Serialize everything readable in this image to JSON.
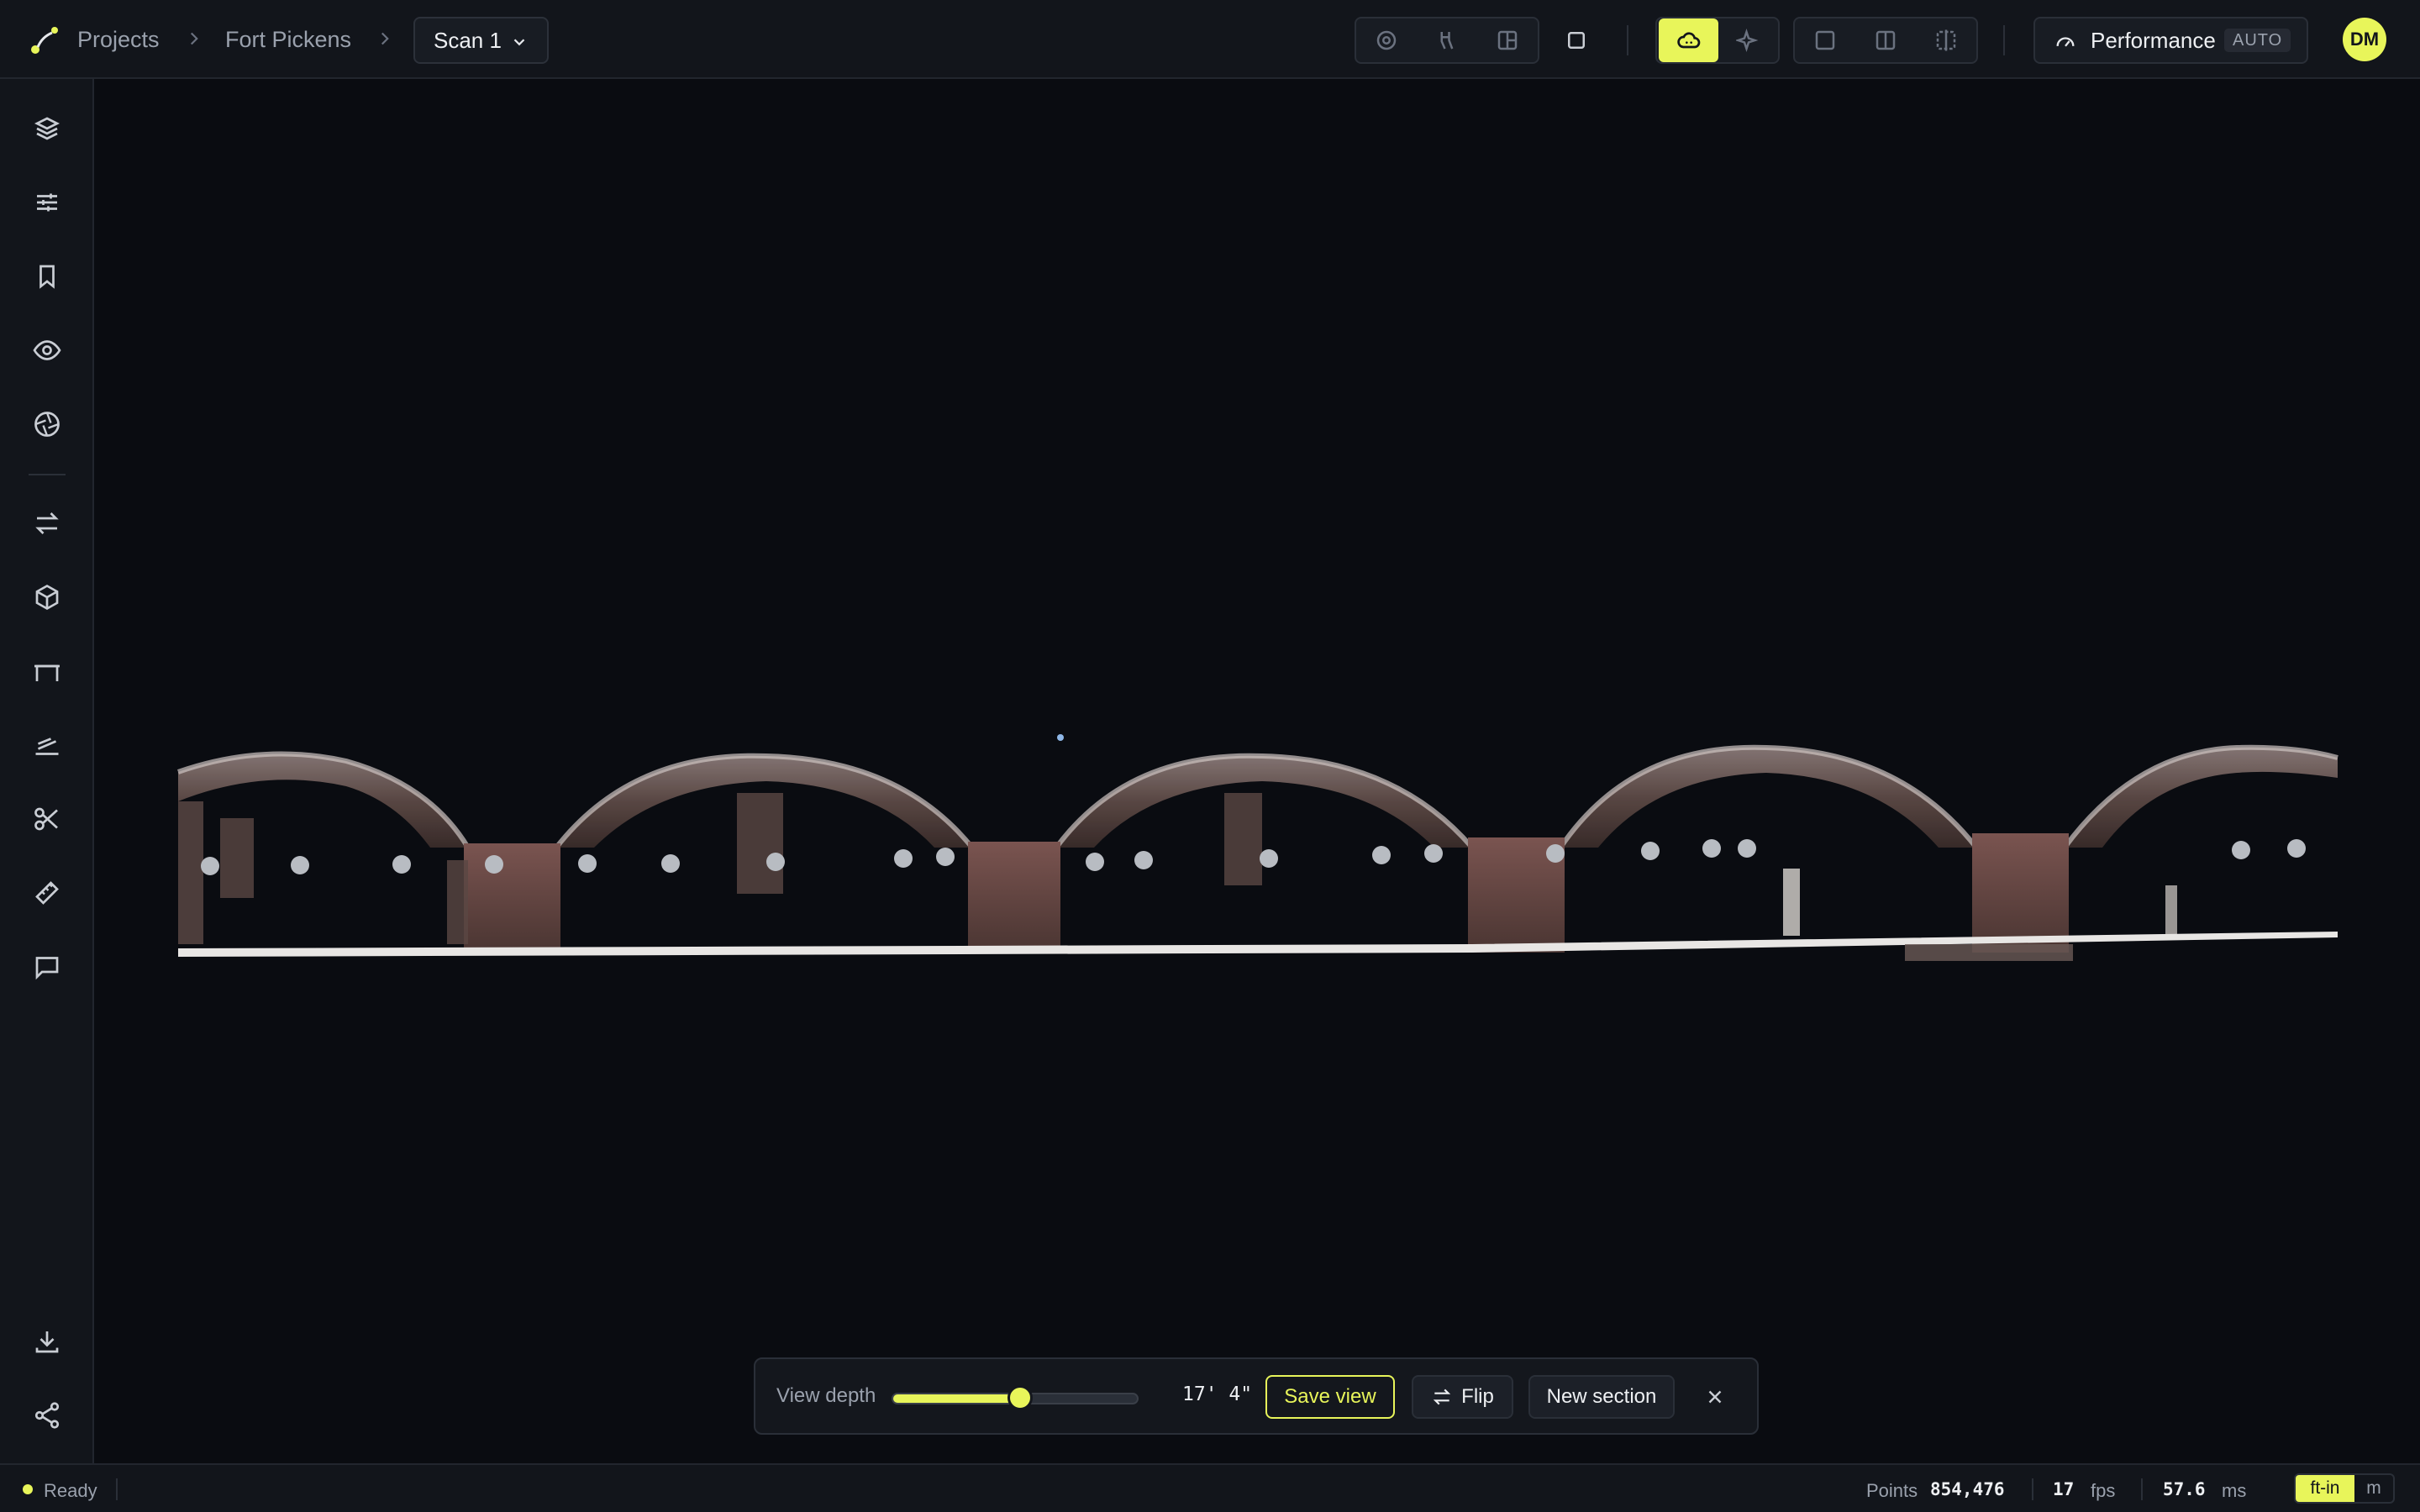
{
  "breadcrumb": {
    "projects": "Projects",
    "site": "Fort Pickens",
    "scan": "Scan 1"
  },
  "toolbar": {
    "performance_label": "Performance",
    "performance_mode": "AUTO",
    "avatar_initials": "DM",
    "accent_color": "#e8f55a",
    "icons": [
      "camera-orbit-icon",
      "walk-icon",
      "layout-icon",
      "square-icon",
      "cloud-icon",
      "sparkle-icon",
      "single-pane-icon",
      "split-pane-icon",
      "compare-pane-icon",
      "gauge-icon"
    ]
  },
  "sidebar": {
    "items": [
      "layers-icon",
      "sliders-icon",
      "bookmark-icon",
      "eye-icon",
      "aperture-icon",
      "swap-icon",
      "cube-icon",
      "section-icon",
      "elevation-icon",
      "scissors-icon",
      "ruler-icon",
      "comment-icon",
      "download-icon",
      "share-icon"
    ]
  },
  "section_toolbar": {
    "view_depth_label": "View depth",
    "view_depth_fraction": 0.52,
    "depth_value": "17' 4\"",
    "save_label": "Save view",
    "flip_label": "Flip",
    "new_section_label": "New section"
  },
  "status": {
    "state": "Ready",
    "points_label": "Points",
    "points_value": "854,476",
    "fps_value": "17",
    "fps_label": "fps",
    "ms_value": "57.6",
    "ms_label": "ms",
    "unit_imperial": "ft-in",
    "unit_metric": "m"
  }
}
